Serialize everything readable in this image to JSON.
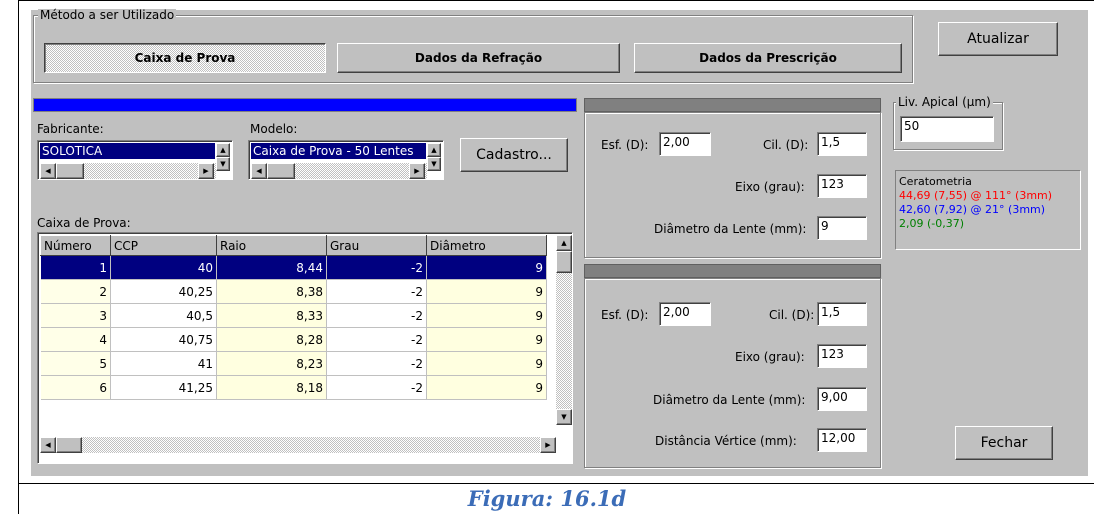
{
  "method_group": {
    "title": "Método a ser Utilizado",
    "buttons": [
      "Caixa de Prova",
      "Dados da Refração",
      "Dados da Prescrição"
    ]
  },
  "actions": {
    "update_label": "Atualizar",
    "close_label": "Fechar",
    "register_label": "Cadastro..."
  },
  "manufacturer": {
    "label": "Fabricante:",
    "selected": "SOLOTICA"
  },
  "model": {
    "label": "Modelo:",
    "selected": "Caixa de Prova - 50 Lentes"
  },
  "trial_box": {
    "label": "Caixa de Prova:",
    "columns": [
      "Número",
      "CCP",
      "Raio",
      "Grau",
      "Diâmetro"
    ],
    "rows": [
      [
        "1",
        "40",
        "8,44",
        "-2",
        "9"
      ],
      [
        "2",
        "40,25",
        "8,38",
        "-2",
        "9"
      ],
      [
        "3",
        "40,5",
        "8,33",
        "-2",
        "9"
      ],
      [
        "4",
        "40,75",
        "8,28",
        "-2",
        "9"
      ],
      [
        "5",
        "41",
        "8,23",
        "-2",
        "9"
      ],
      [
        "6",
        "41,25",
        "8,18",
        "-2",
        "9"
      ]
    ]
  },
  "upper_panel": {
    "esf_label": "Esf. (D):",
    "esf_value": "2,00",
    "cil_label": "Cil. (D):",
    "cil_value": "1,5",
    "eixo_label": "Eixo (grau):",
    "eixo_value": "123",
    "diam_label": "Diâmetro da Lente (mm):",
    "diam_value": "9"
  },
  "lower_panel": {
    "esf_label": "Esf. (D):",
    "esf_value": "2,00",
    "cil_label": "Cil. (D):",
    "cil_value": "1,5",
    "eixo_label": "Eixo (grau):",
    "eixo_value": "123",
    "diam_label": "Diâmetro da Lente (mm):",
    "diam_value": "9,00",
    "vertex_label": "Distância Vértice (mm):",
    "vertex_value": "12,00"
  },
  "apical": {
    "label": "Liv. Apical (µm)",
    "value": "50"
  },
  "keratometry": {
    "title": "Ceratometria",
    "line1": "44,69 (7,55) @ 111° (3mm)",
    "line2": "42,60 (7,92) @ 21° (3mm)",
    "line3": "2,09 (-0,37)",
    "colors": {
      "line1": "#ff0000",
      "line2": "#0000ff",
      "line3": "#008000"
    }
  },
  "caption": "Figura: 16.1d"
}
